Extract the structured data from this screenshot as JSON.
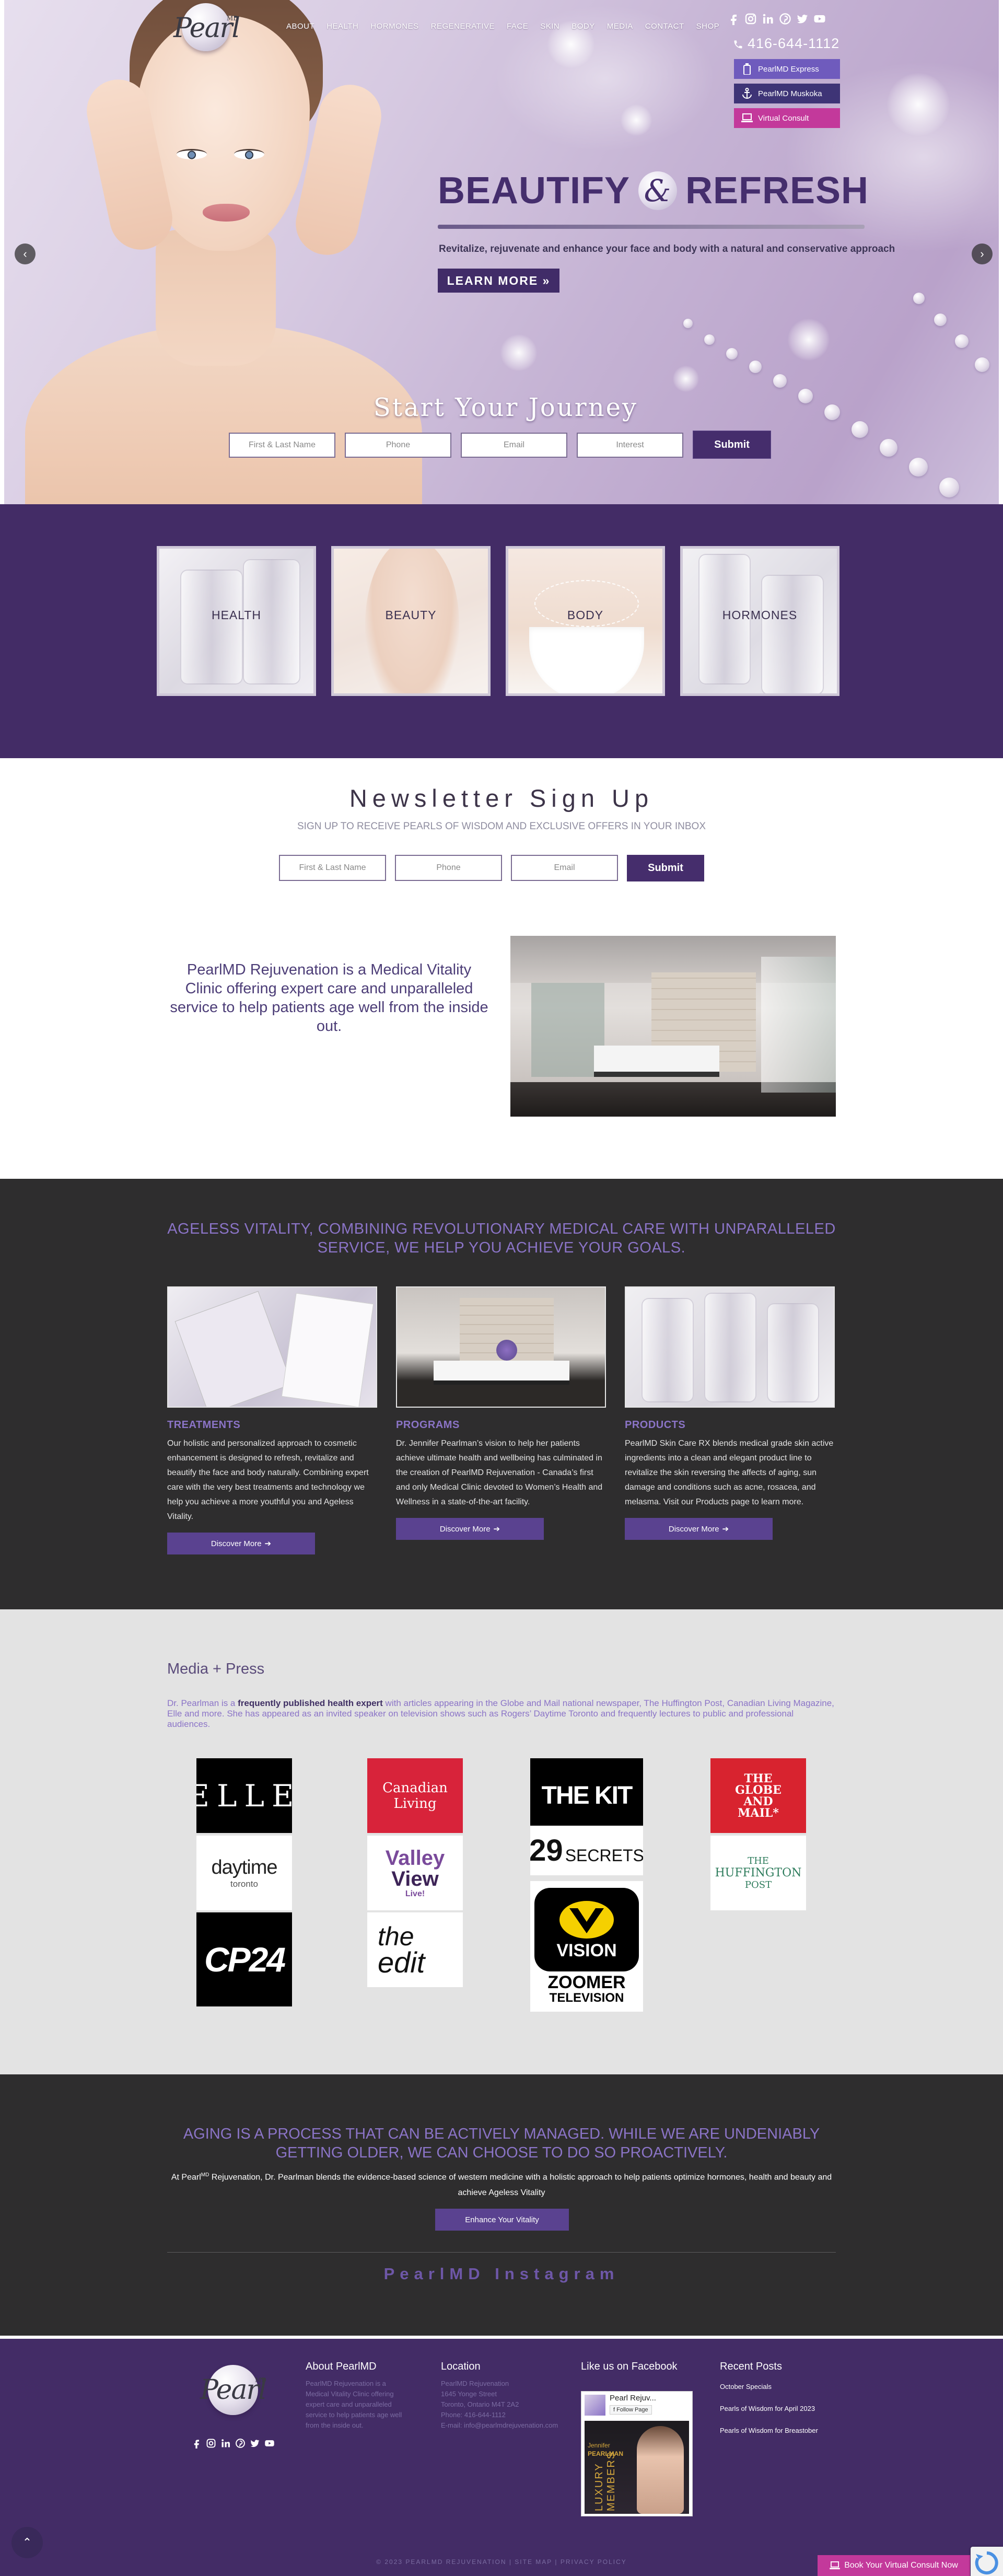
{
  "header": {
    "logo_text": "Pearl",
    "logo_sup": "MD",
    "nav": [
      "ABOUT",
      "HEALTH",
      "HORMONES",
      "REGENERATIVE",
      "FACE",
      "SKIN",
      "BODY",
      "MEDIA",
      "CONTACT",
      "SHOP"
    ],
    "social_icons": [
      "facebook-icon",
      "instagram-icon",
      "linkedin-icon",
      "pinterest-icon",
      "twitter-icon",
      "youtube-icon"
    ],
    "phone": "416-644-1112",
    "side_buttons": [
      {
        "label": "PearlMD Express",
        "icon": "bottle-icon",
        "color": "#6f5bbd"
      },
      {
        "label": "PearlMD Muskoka",
        "icon": "anchor-icon",
        "color": "#3e3476"
      },
      {
        "label": "Virtual Consult",
        "icon": "laptop-icon",
        "color": "#c3399b"
      }
    ]
  },
  "hero": {
    "title_left": "BEAUTIFY",
    "title_amp": "&",
    "title_right": "REFRESH",
    "subtitle": "Revitalize, rejuvenate and enhance your face and body with a natural and conservative approach",
    "cta": "LEARN MORE »",
    "prev": "‹",
    "next": "›",
    "journey_title": "Start Your Journey",
    "form": {
      "name": "First & Last Name",
      "phone": "Phone",
      "email": "Email",
      "interest": "Interest",
      "submit": "Submit"
    }
  },
  "categories": [
    "HEALTH",
    "BEAUTY",
    "BODY",
    "HORMONES"
  ],
  "newsletter": {
    "title": "Newsletter Sign Up",
    "subtitle": "SIGN UP TO RECEIVE PEARLS OF WISDOM AND EXCLUSIVE OFFERS IN YOUR INBOX",
    "name": "First & Last Name",
    "phone": "Phone",
    "email": "Email",
    "submit": "Submit"
  },
  "about": {
    "text": "PearlMD Rejuvenation is a Medical Vitality Clinic offering expert care and unparalleled service to help patients age well from the inside out."
  },
  "vitality": {
    "heading": "AGELESS VITALITY, COMBINING REVOLUTIONARY MEDICAL CARE WITH UNPARALLELED SERVICE, WE HELP YOU ACHIEVE YOUR GOALS.",
    "cards": [
      {
        "title": "TREATMENTS",
        "text": "Our holistic and personalized approach to cosmetic enhancement is designed to refresh, revitalize and beautify the face and body naturally. Combining expert care with the very best treatments and technology we help you achieve a more youthful you and Ageless Vitality.",
        "button": "Discover More"
      },
      {
        "title": "PROGRAMS",
        "text": "Dr. Jennifer Pearlman’s vision to help her patients achieve ultimate health and wellbeing has culminated in the creation of PearlMD Rejuvenation - Canada’s first and only Medical Clinic devoted to Women’s Health and Wellness in a state-of-the-art facility.",
        "button": "Discover More"
      },
      {
        "title": "PRODUCTS",
        "text": "PearlMD Skin Care RX blends medical grade skin active ingredients into a clean and elegant product line to revitalize the skin reversing the affects of aging, sun damage and conditions such as acne, rosacea, and melasma. Visit our Products page to learn more.",
        "button": "Discover More"
      }
    ]
  },
  "media": {
    "title": "Media + Press",
    "text_before": "Dr. Pearlman is a ",
    "text_bold": "frequently published health expert",
    "text_after": " with articles appearing in the Globe and Mail national newspaper, The Huffington Post, Canadian Living Magazine, Elle and more. She has appeared as an invited speaker on television shows such as Rogers’ Daytime Toronto and frequently lectures to public and professional audiences.",
    "logos": {
      "elle": "ELLE",
      "canadian_living_1": "Canadian",
      "canadian_living_2": "Living",
      "the_kit": "THE KIT",
      "globe_1": "THE",
      "globe_2": "GLOBE",
      "globe_3": "AND",
      "globe_4": "MAIL*",
      "daytime_1": "daytime",
      "daytime_2": "toronto",
      "valley_1": "Valley",
      "valley_2": "View",
      "valley_3": "Live!",
      "secrets_num": "29",
      "secrets_word": "SECRETS",
      "huff_1": "THE",
      "huff_2": "HUFFINGTON",
      "huff_3": "POST",
      "cp24": "CP24",
      "edit_1": "the",
      "edit_2": "edit",
      "vision": "VISION",
      "zoomer_1": "ZOOMER",
      "zoomer_2": "TELEVISION"
    }
  },
  "aging": {
    "heading": "AGING IS A PROCESS THAT CAN BE ACTIVELY MANAGED. WHILE WE ARE UNDENIABLY GETTING OLDER, WE CAN CHOOSE TO DO SO PROACTIVELY.",
    "text_a": "At Pearl",
    "text_sup": "MD",
    "text_b": " Rejuvenation, Dr. Pearlman blends the evidence-based science of western medicine with a holistic approach to help patients optimize hormones, health and beauty and achieve Ageless Vitality",
    "button": "Enhance Your Vitality",
    "instagram": "PearlMD Instagram"
  },
  "footer": {
    "about_title": "About PearlMD",
    "about_text": "PearlMD Rejuvenation is a Medical Vitality Clinic offering expert care and unparalleled service to help patients age well from the inside out.",
    "location_title": "Location",
    "location_lines": [
      "PearlMD Rejuvenation",
      "1645 Yonge Street",
      "Toronto, Ontario M4T 2A2",
      "Phone: 416-644-1112",
      "E-mail: info@pearlmdrejuvenation.com"
    ],
    "facebook_title": "Like us on Facebook",
    "fb_name": "Pearl Rejuv...",
    "fb_follow": "Follow Page",
    "fb_person_1": "Jennifer",
    "fb_person_2": "PEARLMAN",
    "fb_banner": "LUXURY MEMBERS",
    "posts_title": "Recent Posts",
    "posts": [
      "October Specials",
      "Pearls of Wisdom for April 2023",
      "Pearls of Wisdom for Breastober"
    ],
    "copyright": "© 2023 PEARLMD REJUVENATION | SITE MAP | PRIVACY POLICY",
    "book_button": "Book Your Virtual Consult Now",
    "back_to_top": "⌃"
  }
}
